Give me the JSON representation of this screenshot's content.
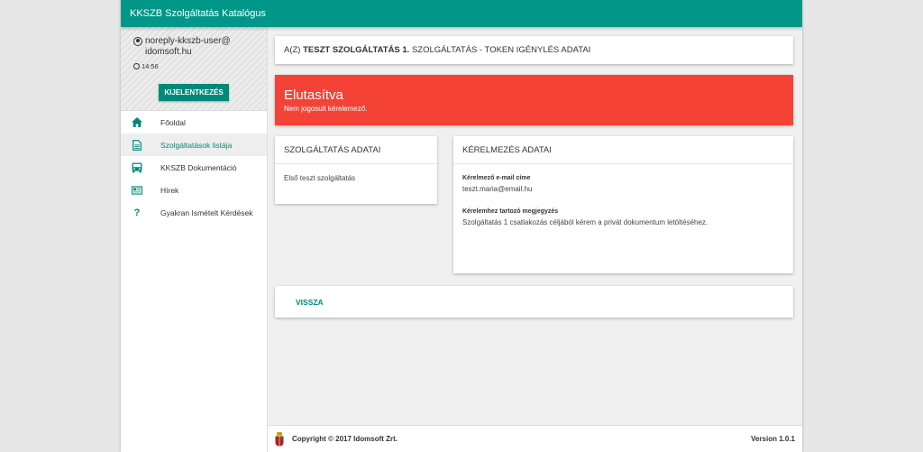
{
  "app": {
    "title": "KKSZB Szolgáltatás Katalógus"
  },
  "user": {
    "email": "noreply-kkszb-user@idomsoft.hu",
    "time": "14:56",
    "logout_label": "KIJELENTKEZÉS"
  },
  "sidebar": {
    "items": [
      {
        "label": "Főoldal",
        "icon": "home-icon"
      },
      {
        "label": "Szolgáltatások listája",
        "icon": "document-icon",
        "active": true
      },
      {
        "label": "KKSZB Dokumentáció",
        "icon": "bus-icon"
      },
      {
        "label": "Hírek",
        "icon": "news-icon"
      },
      {
        "label": "Gyakran Ismételt Kérdések",
        "icon": "question-icon"
      }
    ]
  },
  "page": {
    "title_prefix": "A(Z)",
    "title_service": "TESZT SZOLGÁLTATÁS 1.",
    "title_suffix": "SZOLGÁLTATÁS - TOKEN IGÉNYLÉS ADATAI"
  },
  "status": {
    "title": "Elutasítva",
    "message": "Nem jogosult kérelemező.",
    "color": "#f44336"
  },
  "service_card": {
    "heading": "SZOLGÁLTATÁS ADATAI",
    "description": "Első teszt szolgáltatás"
  },
  "request_card": {
    "heading": "KÉRELMEZÉS ADATAI",
    "email_label": "Kérelmező e-mail címe",
    "email_value": "teszt.maria@email.hu",
    "note_label": "Kérelemhez tartozó megjegyzés",
    "note_value": "Szolgáltatás 1 csatlakozás céljából kérem a privát dokumentum letöltéséhez."
  },
  "back": {
    "label": "VISSZA"
  },
  "footer": {
    "copyright": "Copyright © 2017 Idomsoft Zrt.",
    "version": "Version 1.0.1"
  },
  "colors": {
    "accent": "#009688",
    "accent_dark": "#00897b"
  }
}
